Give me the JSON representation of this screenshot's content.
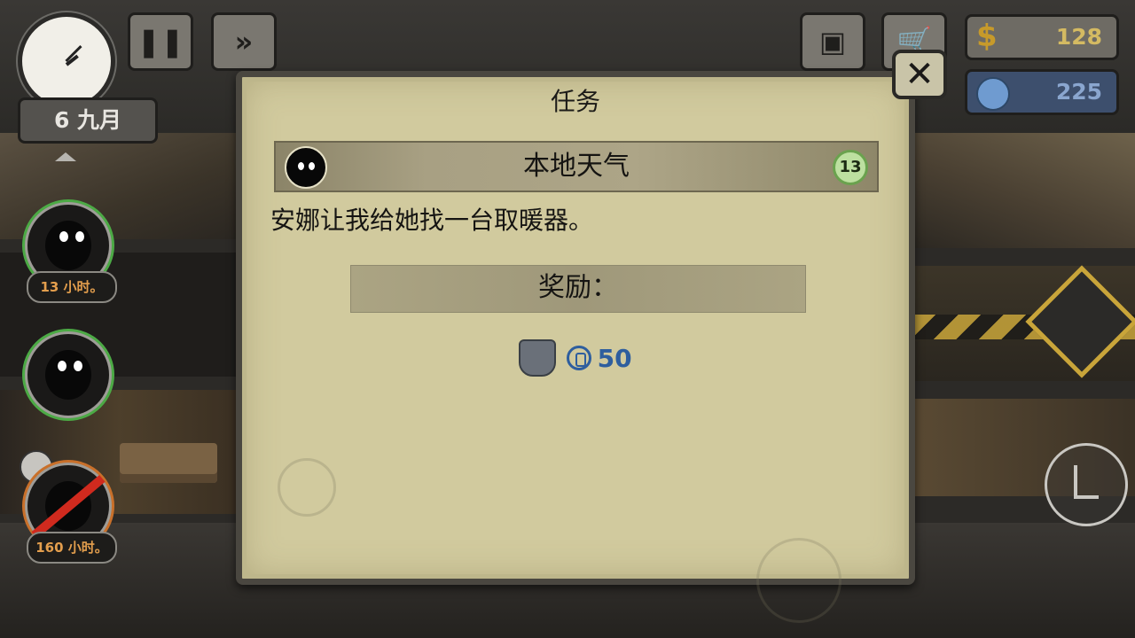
{
  "hud": {
    "date_label": "6 九月",
    "pause_icon": "pause-icon",
    "fast_forward_icon": "fast-forward-icon",
    "backpack_icon": "backpack-icon",
    "cart_icon": "cart-icon",
    "money": {
      "symbol": "$",
      "value": "128",
      "color": "#c79a2a"
    },
    "reputation": {
      "icon": "reputation-icon",
      "value": "225",
      "color": "#8aa6cf"
    }
  },
  "characters": [
    {
      "name": "tenant-1",
      "timer": "13 小时。",
      "ring": "#4caa45"
    },
    {
      "name": "tenant-2",
      "ring": "#4caa45"
    },
    {
      "name": "tenant-3",
      "timer": "160 小时。",
      "ring": "#c9702a"
    }
  ],
  "dialog": {
    "title": "任务",
    "close_icon": "close-icon",
    "quest": {
      "name": "本地天气",
      "level": "13",
      "description": "安娜让我给她找一台取暖器。"
    },
    "reward_label": "奖励：",
    "reward": {
      "item_icon": "shield-icon",
      "currency_icon": "reputation-icon",
      "value": "50",
      "color": "#2e5e9e"
    }
  }
}
